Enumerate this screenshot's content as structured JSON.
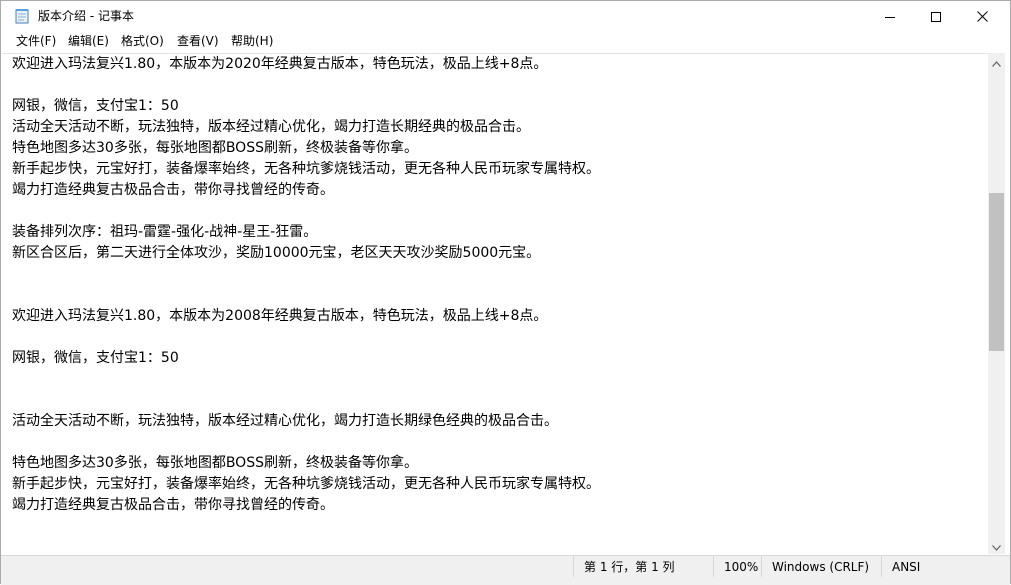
{
  "window": {
    "title": "版本介绍 - 记事本"
  },
  "menu": {
    "file": "文件(F)",
    "edit": "编辑(E)",
    "format": "格式(O)",
    "view": "查看(V)",
    "help": "帮助(H)"
  },
  "editor": {
    "lines": [
      "欢迎进入玛法复兴1.80，本版本为2020年经典复古版本，特色玩法，极品上线+8点。",
      "",
      "网银，微信，支付宝1：50",
      "活动全天活动不断，玩法独特，版本经过精心优化，竭力打造长期经典的极品合击。",
      "特色地图多达30多张，每张地图都BOSS刷新，终极装备等你拿。",
      "新手起步快，元宝好打，装备爆率始终，无各种坑爹烧钱活动，更无各种人民币玩家专属特权。",
      "竭力打造经典复古极品合击，带你寻找曾经的传奇。",
      "",
      "装备排列次序：祖玛-雷霆-强化-战神-星王-狂雷。",
      "新区合区后，第二天进行全体攻沙，奖励10000元宝，老区天天攻沙奖励5000元宝。",
      "",
      "",
      "欢迎进入玛法复兴1.80，本版本为2008年经典复古版本，特色玩法，极品上线+8点。",
      "",
      "网银，微信，支付宝1：50",
      "",
      "",
      "活动全天活动不断，玩法独特，版本经过精心优化，竭力打造长期绿色经典的极品合击。",
      "",
      "特色地图多达30多张，每张地图都BOSS刷新，终极装备等你拿。",
      "新手起步快，元宝好打，装备爆率始终，无各种坑爹烧钱活动，更无各种人民币玩家专属特权。",
      "竭力打造经典复古极品合击，带你寻找曾经的传奇。"
    ]
  },
  "status": {
    "position": "第 1 行，第 1 列",
    "zoom": "100%",
    "line_ending": "Windows (CRLF)",
    "encoding": "ANSI"
  },
  "icons": {
    "app": "notepad-icon",
    "minimize": "minimize-icon",
    "maximize": "maximize-icon",
    "close": "close-icon"
  }
}
